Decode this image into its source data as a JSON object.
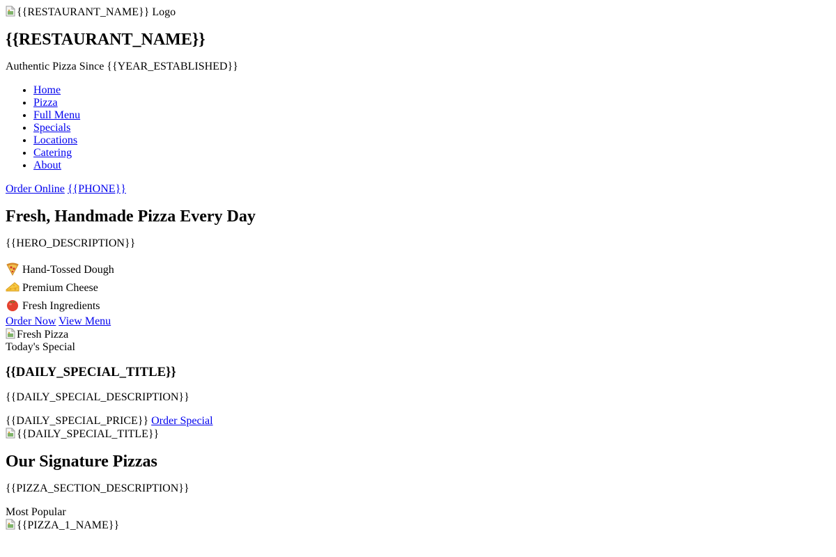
{
  "header": {
    "logo_alt": "{{RESTAURANT_NAME}} Logo",
    "restaurant_name": "{{RESTAURANT_NAME}}",
    "tagline": "Authentic Pizza Since {{YEAR_ESTABLISHED}}"
  },
  "nav": {
    "items": [
      {
        "label": "Home"
      },
      {
        "label": "Pizza"
      },
      {
        "label": "Full Menu"
      },
      {
        "label": "Specials"
      },
      {
        "label": "Locations"
      },
      {
        "label": "Catering"
      },
      {
        "label": "About"
      }
    ]
  },
  "header_actions": {
    "order_online": "Order Online",
    "phone": "{{PHONE}}"
  },
  "hero": {
    "title": "Fresh, Handmade Pizza Every Day",
    "description": "{{HERO_DESCRIPTION}}",
    "features": [
      {
        "icon": "pizza-slice-icon",
        "label": "Hand-Tossed Dough"
      },
      {
        "icon": "cheese-icon",
        "label": "Premium Cheese"
      },
      {
        "icon": "tomato-icon",
        "label": "Fresh Ingredients"
      }
    ],
    "order_now": "Order Now",
    "view_menu": "View Menu",
    "image_alt": "Fresh Pizza"
  },
  "special": {
    "badge": "Today's Special",
    "title": "{{DAILY_SPECIAL_TITLE}}",
    "description": "{{DAILY_SPECIAL_DESCRIPTION}}",
    "price": "{{DAILY_SPECIAL_PRICE}}",
    "order_special": "Order Special",
    "image_alt": "{{DAILY_SPECIAL_TITLE}}"
  },
  "pizzas": {
    "title": "Our Signature Pizzas",
    "description": "{{PIZZA_SECTION_DESCRIPTION}}",
    "badge": "Most Popular",
    "pizza_1_image_alt": "{{PIZZA_1_NAME}}"
  },
  "colors": {
    "link": "#0000ee",
    "text": "#000000",
    "background": "#ffffff"
  }
}
